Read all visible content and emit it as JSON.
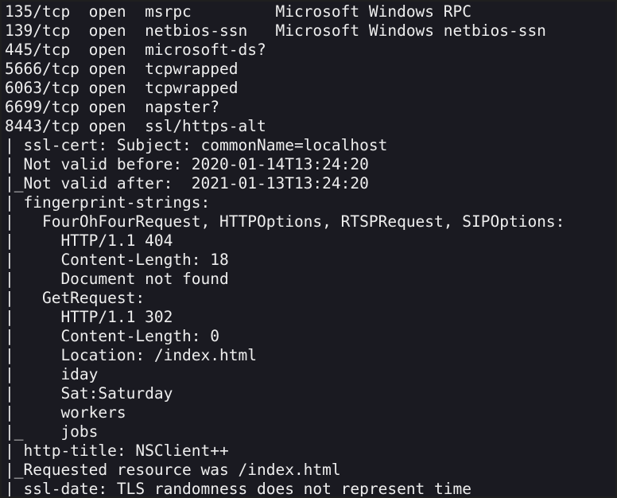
{
  "terminal": {
    "lines": [
      "135/tcp  open  msrpc         Microsoft Windows RPC",
      "139/tcp  open  netbios-ssn   Microsoft Windows netbios-ssn",
      "445/tcp  open  microsoft-ds?",
      "5666/tcp open  tcpwrapped",
      "6063/tcp open  tcpwrapped",
      "6699/tcp open  napster?",
      "8443/tcp open  ssl/https-alt",
      "| ssl-cert: Subject: commonName=localhost",
      "| Not valid before: 2020-01-14T13:24:20",
      "|_Not valid after:  2021-01-13T13:24:20",
      "| fingerprint-strings:",
      "|   FourOhFourRequest, HTTPOptions, RTSPRequest, SIPOptions:",
      "|     HTTP/1.1 404",
      "|     Content-Length: 18",
      "|     Document not found",
      "|   GetRequest:",
      "|     HTTP/1.1 302",
      "|     Content-Length: 0",
      "|     Location: /index.html",
      "|     iday",
      "|     Sat:Saturday",
      "|     workers",
      "|_    jobs",
      "| http-title: NSClient++",
      "|_Requested resource was /index.html",
      "|_ssl-date: TLS randomness does not represent time"
    ]
  },
  "colors": {
    "background": "#1a1a21",
    "foreground": "#eeeeee",
    "border": "#1f1f1f"
  }
}
